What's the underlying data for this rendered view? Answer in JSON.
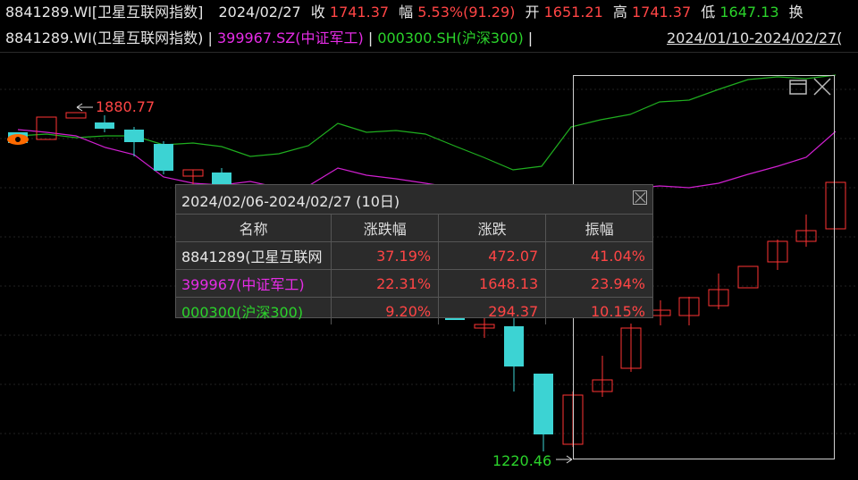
{
  "header": {
    "symbol": "8841289.WI[卫星互联网指数]",
    "date": "2024/02/27",
    "close_label": "收",
    "close_value": "1741.37",
    "change_label": "幅",
    "change_value": "5.53%(91.29)",
    "open_label": "开",
    "open_value": "1651.21",
    "high_label": "高",
    "high_value": "1741.37",
    "low_label": "低",
    "low_value": "1647.13",
    "cut_label": "换"
  },
  "legend": {
    "main": "8841289.WI(卫星互联网指数) |",
    "series2": "399967.SZ(中证军工)",
    "sep2": "|",
    "series3": "000300.SH(沪深300)",
    "sep3": "|",
    "range": "2024/01/10-2024/02/27("
  },
  "annotations": {
    "high_price": "1880.77",
    "low_price": "1220.46"
  },
  "popup": {
    "title": "2024/02/06-2024/02/27 (10日)",
    "columns": [
      "名称",
      "涨跌幅",
      "涨跌",
      "振幅"
    ],
    "rows": [
      {
        "name": "8841289(卫星互联网",
        "pct": "37.19%",
        "change": "472.07",
        "amplitude": "41.04%"
      },
      {
        "name": "399967(中证军工)",
        "pct": "22.31%",
        "change": "1648.13",
        "amplitude": "23.94%"
      },
      {
        "name": "000300(沪深300)",
        "pct": "9.20%",
        "change": "294.37",
        "amplitude": "10.15%"
      }
    ]
  },
  "colors": {
    "up": "#ff3333",
    "down": "#3cd3d3",
    "csi300": "#1fae1f",
    "military": "#d020d0",
    "background": "#000000"
  },
  "icons": {
    "eye": "eye-icon",
    "maximize": "window-icon",
    "close": "close-icon"
  }
}
